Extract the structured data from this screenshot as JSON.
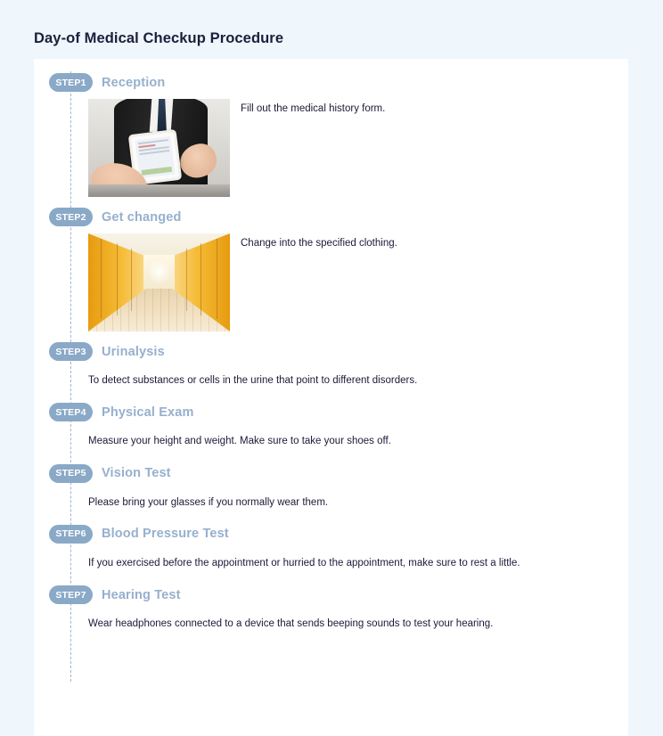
{
  "page": {
    "title": "Day-of Medical Checkup Procedure",
    "background_color": "#eff6fc",
    "card_color": "#ffffff",
    "badge_color": "#8aa9c7",
    "step_title_color": "#96b0cd",
    "connector_color": "#9fb6cf"
  },
  "steps": [
    {
      "badge": "STEP1",
      "title": "Reception",
      "description": "Fill out the medical history form.",
      "media": "reception-photo"
    },
    {
      "badge": "STEP2",
      "title": "Get changed",
      "description": "Change into the specified clothing.",
      "media": "lockers-photo"
    },
    {
      "badge": "STEP3",
      "title": "Urinalysis",
      "description": "To detect substances or cells in the urine that point to different disorders.",
      "media": null
    },
    {
      "badge": "STEP4",
      "title": "Physical Exam",
      "description": "Measure your height and weight. Make sure to take your shoes off.",
      "media": null
    },
    {
      "badge": "STEP5",
      "title": "Vision Test",
      "description": "Please bring your glasses if you normally wear them.",
      "media": null
    },
    {
      "badge": "STEP6",
      "title": "Blood Pressure Test",
      "description": "If you exercised before the appointment or hurried to the appointment, make sure to rest a little.",
      "media": null
    },
    {
      "badge": "STEP7",
      "title": "Hearing Test",
      "description": "Wear headphones connected to a device that sends beeping sounds to test your hearing.",
      "media": null
    }
  ]
}
